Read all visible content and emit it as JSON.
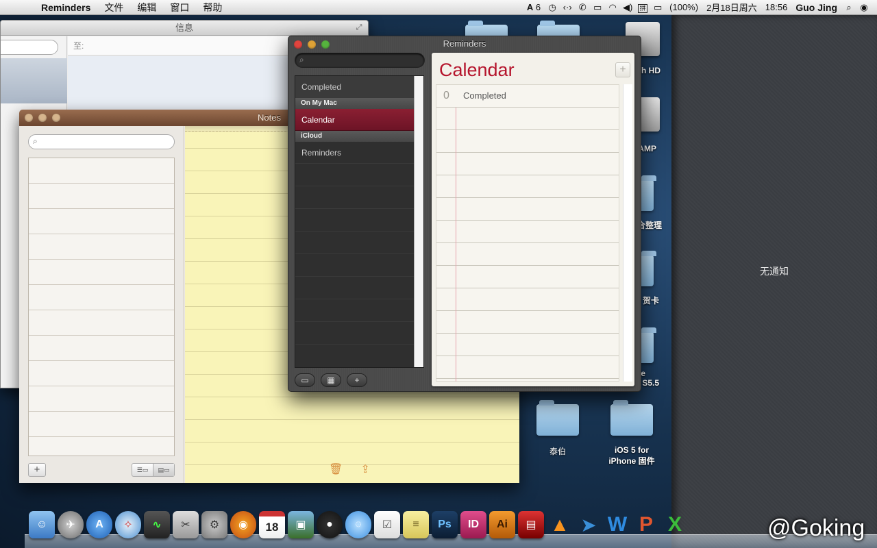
{
  "menubar": {
    "app": "Reminders",
    "items": [
      "文件",
      "编辑",
      "窗口",
      "帮助"
    ],
    "adobe": "6",
    "battery": "(100%)",
    "date": "2月18日周六",
    "time": "18:56",
    "user": "Guo Jing",
    "input_method": "拼"
  },
  "notifications": {
    "empty": "无通知"
  },
  "desktop": {
    "drive_label": "h HD",
    "amp_label": "AMP",
    "folder_labels": [
      "合整理",
      "贺卡",
      "S5.5",
      "泰伯",
      "iOS 5 for\niPhone 固件"
    ],
    "ios_line1": "iOS 5 for",
    "ios_line2": "iPhone 固件",
    "taibo": "泰伯",
    "e_label": "e"
  },
  "messages": {
    "title": "信息",
    "to_label": "至:"
  },
  "notes": {
    "title": "Notes"
  },
  "reminders": {
    "title": "Reminders",
    "top_item": "Completed",
    "groups": [
      {
        "header": "On My Mac",
        "items": [
          "Calendar"
        ]
      },
      {
        "header": "iCloud",
        "items": [
          "Reminders"
        ]
      }
    ],
    "selected_list": "Calendar",
    "pad": {
      "title": "Calendar",
      "completed_count": "0",
      "completed_label": "Completed"
    }
  },
  "dock": {
    "icons": [
      "finder-icon",
      "launchpad-icon",
      "app-store-icon",
      "safari-icon",
      "activity-monitor-icon",
      "grapher-icon",
      "system-preferences-icon",
      "firefox-icon",
      "calendar-icon",
      "iphoto-icon",
      "qq-icon",
      "messages-icon",
      "reminders-icon",
      "notes-icon",
      "photoshop-icon",
      "indesign-icon",
      "illustrator-icon",
      "photo-booth-icon",
      "vlc-icon",
      "xcode-icon",
      "word-icon",
      "powerpoint-icon",
      "excel-icon"
    ],
    "calendar_day": "18",
    "ps": "Ps",
    "id": "ID",
    "ai": "Ai"
  },
  "watermark": "@Goking"
}
